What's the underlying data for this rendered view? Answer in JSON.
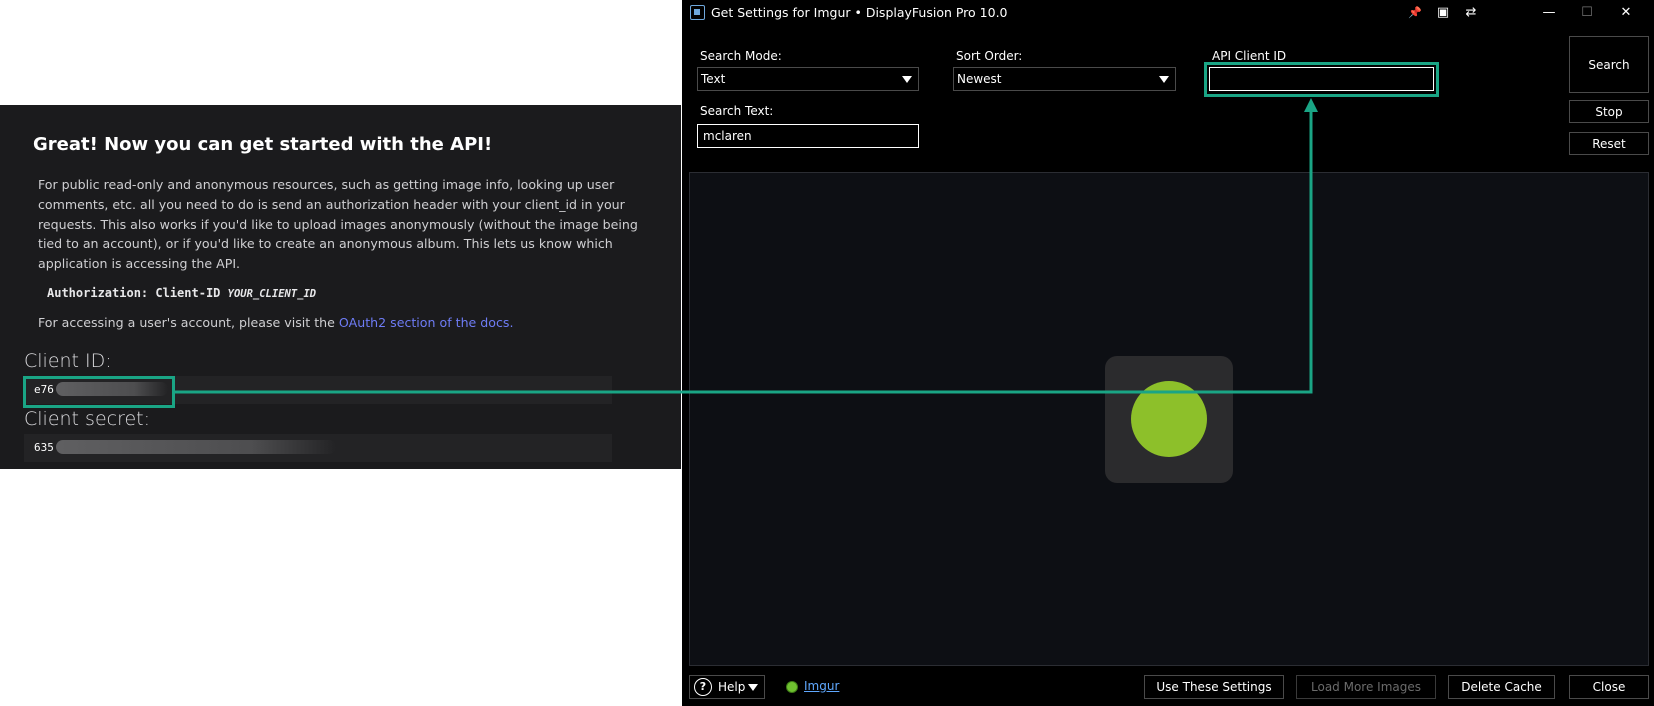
{
  "imgur_panel": {
    "heading": "Great! Now you can get started with the API!",
    "paragraph": "For public read-only and anonymous resources, such as getting image info, looking up user comments, etc. all you need to do is send an authorization header with your client_id in your requests. This also works if you'd like to upload images anonymously (without the image being tied to an account), or if you'd like to create an anonymous album. This lets us know which application is accessing the API.",
    "auth_header": "Authorization: Client-ID",
    "auth_placeholder": "YOUR_CLIENT_ID",
    "oauth_text": "For accessing a user's account, please visit the",
    "oauth_link": "OAuth2 section of the docs.",
    "client_id_label": "Client ID:",
    "client_id_value": "e76",
    "client_secret_label": "Client secret:",
    "client_secret_value": "635"
  },
  "window": {
    "title": "Get Settings for Imgur • DisplayFusion Pro 10.0",
    "titlebar_icons": [
      "pin-icon",
      "monitor-icon",
      "move-monitor-icon",
      "minimize-icon",
      "maximize-icon",
      "close-icon"
    ],
    "titlebar_glyphs": {
      "pin": "📌",
      "monitor": "▣",
      "move": "⇄",
      "minimize": "—",
      "maximize": "☐",
      "close": "✕"
    }
  },
  "form": {
    "search_mode_label": "Search Mode:",
    "search_mode_value": "Text",
    "sort_order_label": "Sort Order:",
    "sort_order_value": "Newest",
    "api_client_id_label": "API Client ID",
    "api_client_id_value": "",
    "search_text_label": "Search Text:",
    "search_text_value": "mclaren"
  },
  "buttons": {
    "search": "Search",
    "stop": "Stop",
    "reset": "Reset",
    "use_settings": "Use These Settings",
    "load_more": "Load More Images",
    "delete_cache": "Delete Cache",
    "close": "Close"
  },
  "footer": {
    "help_label": "Help",
    "help_glyph": "?",
    "provider_link": "Imgur"
  },
  "colors": {
    "highlight": "#1aa585",
    "spinner_dot": "#8dc02a",
    "imgur_bg": "#1b1b1d",
    "window_bg": "#000000",
    "link": "#6e7cf5"
  }
}
